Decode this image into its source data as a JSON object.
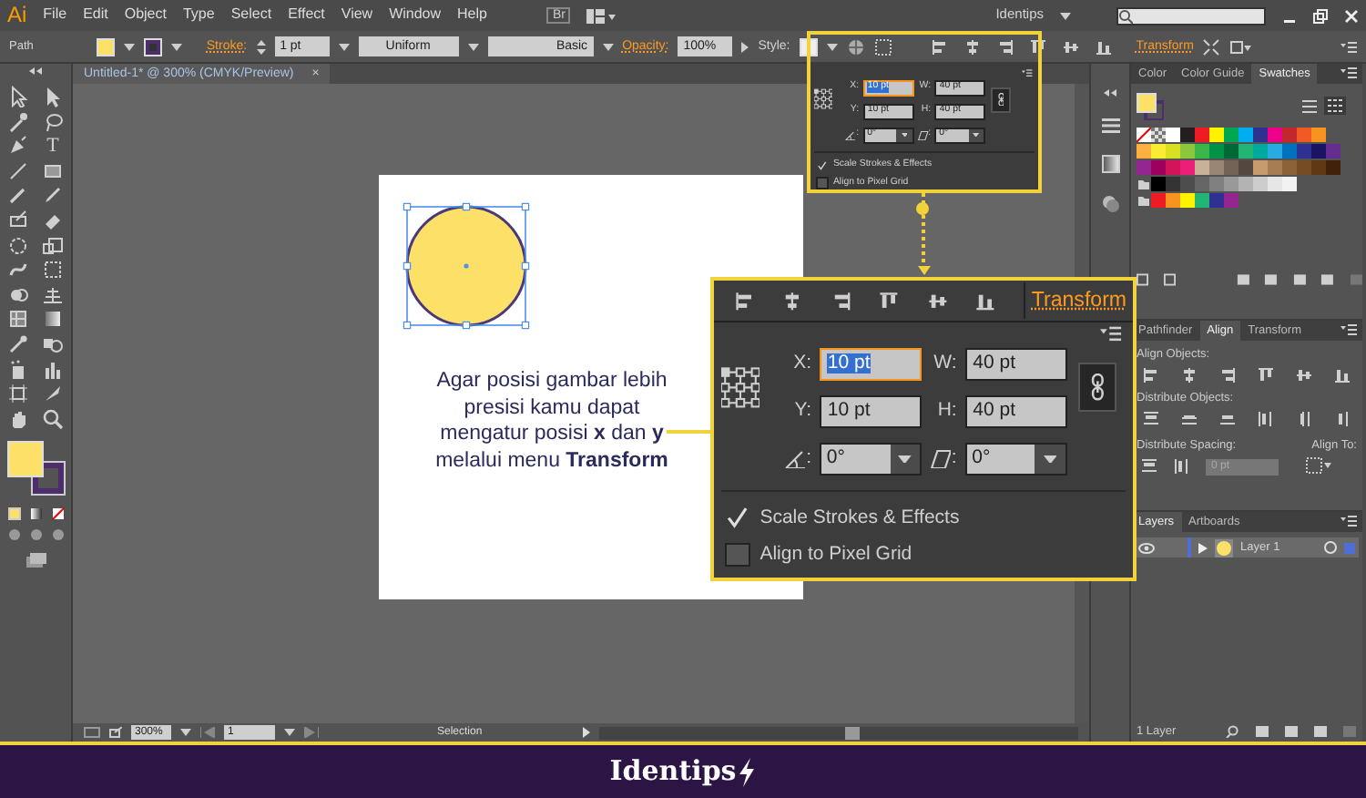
{
  "app": {
    "logo": "Ai",
    "bridge": "Br",
    "workspace": "Identips"
  },
  "menu": [
    "File",
    "Edit",
    "Object",
    "Type",
    "Select",
    "Effect",
    "View",
    "Window",
    "Help"
  ],
  "control_bar": {
    "object_type": "Path",
    "stroke_label": "Stroke:",
    "stroke_weight": "1 pt",
    "profile": "Uniform",
    "brush": "Basic",
    "opacity_label": "Opacity:",
    "opacity": "100%",
    "style_label": "Style:",
    "transform_link": "Transform"
  },
  "toolbar": {
    "type_tool": "T"
  },
  "document_tab": {
    "title": "Untitled-1* @ 300% (CMYK/Preview)",
    "close": "×"
  },
  "artboard": {
    "shape_selected": true,
    "note": "Agar posisi gambar lebih presisi kamu dapat mengatur posisi **x** dan **y** melalui menu **Transform**"
  },
  "transform_popup": {
    "fields": [
      {
        "label": "X:",
        "value": "10 pt",
        "focused": true
      },
      {
        "label": "W:",
        "value": "40 pt",
        "focused": false
      },
      {
        "label": "Y:",
        "value": "10 pt",
        "focused": false
      },
      {
        "label": "H:",
        "value": "40 pt",
        "focused": false
      }
    ],
    "angles": [
      {
        "kind": "rotate",
        "label": ":",
        "value": "0°"
      },
      {
        "kind": "shear",
        "label": ":",
        "value": "0°"
      }
    ],
    "options": [
      {
        "label": "Scale Strokes & Effects",
        "checked": true
      },
      {
        "label": "Align to Pixel Grid",
        "checked": false
      }
    ]
  },
  "transform_panel": {
    "tab": "Transform",
    "fields": [
      {
        "label": "X:",
        "value": "10 pt",
        "focused": true
      },
      {
        "label": "W:",
        "value": "40 pt",
        "focused": false
      },
      {
        "label": "Y:",
        "value": "10 pt",
        "focused": false
      },
      {
        "label": "H:",
        "value": "40 pt",
        "focused": false
      }
    ],
    "angles": [
      {
        "kind": "rotate",
        "label": ":",
        "value": "0°"
      },
      {
        "kind": "shear",
        "label": ":",
        "value": "0°"
      }
    ],
    "options": [
      {
        "label": "Scale Strokes & Effects",
        "checked": true
      },
      {
        "label": "Align to Pixel Grid",
        "checked": false
      }
    ]
  },
  "color_panel": {
    "tabs": [
      {
        "label": "Color",
        "selected": false
      },
      {
        "label": "Color Guide",
        "selected": false
      },
      {
        "label": "Swatches",
        "selected": true
      }
    ],
    "swatch_rows": [
      {
        "group": false,
        "swatches": [
          {
            "kind": "none"
          },
          {
            "kind": "registration"
          },
          {
            "kind": "color",
            "color": "#ffffff"
          },
          {
            "kind": "color",
            "color": "#231f20"
          },
          {
            "kind": "color",
            "color": "#ed1c24"
          },
          {
            "kind": "color",
            "color": "#fff200"
          },
          {
            "kind": "color",
            "color": "#00a651"
          },
          {
            "kind": "color",
            "color": "#00aeef"
          },
          {
            "kind": "color",
            "color": "#2e3192"
          },
          {
            "kind": "color",
            "color": "#ec008c"
          },
          {
            "kind": "color",
            "color": "#c1272d"
          },
          {
            "kind": "color",
            "color": "#f15a24"
          },
          {
            "kind": "color",
            "color": "#f7931e"
          }
        ]
      },
      {
        "group": false,
        "swatches": [
          {
            "kind": "color",
            "color": "#fbb040"
          },
          {
            "kind": "color",
            "color": "#f9ed32"
          },
          {
            "kind": "color",
            "color": "#d9e021"
          },
          {
            "kind": "color",
            "color": "#8cc63f"
          },
          {
            "kind": "color",
            "color": "#39b54a"
          },
          {
            "kind": "color",
            "color": "#009245"
          },
          {
            "kind": "color",
            "color": "#006837"
          },
          {
            "kind": "color",
            "color": "#22b573"
          },
          {
            "kind": "color",
            "color": "#00a99d"
          },
          {
            "kind": "color",
            "color": "#29abe2"
          },
          {
            "kind": "color",
            "color": "#0071bc"
          },
          {
            "kind": "color",
            "color": "#2e3192"
          },
          {
            "kind": "color",
            "color": "#1b1464"
          },
          {
            "kind": "color",
            "color": "#662d91"
          }
        ]
      },
      {
        "group": false,
        "swatches": [
          {
            "kind": "color",
            "color": "#93278f"
          },
          {
            "kind": "color",
            "color": "#9e005d"
          },
          {
            "kind": "color",
            "color": "#d4145a"
          },
          {
            "kind": "color",
            "color": "#ed1e79"
          },
          {
            "kind": "color",
            "color": "#c7b299"
          },
          {
            "kind": "color",
            "color": "#998675"
          },
          {
            "kind": "color",
            "color": "#736357"
          },
          {
            "kind": "color",
            "color": "#534741"
          },
          {
            "kind": "color",
            "color": "#c69c6d"
          },
          {
            "kind": "color",
            "color": "#a67c52"
          },
          {
            "kind": "color",
            "color": "#8c6239"
          },
          {
            "kind": "color",
            "color": "#754c24"
          },
          {
            "kind": "color",
            "color": "#603813"
          },
          {
            "kind": "color",
            "color": "#42210b"
          }
        ]
      },
      {
        "group": true,
        "swatches": [
          {
            "kind": "color",
            "color": "#000000"
          },
          {
            "kind": "color",
            "color": "#333333"
          },
          {
            "kind": "color",
            "color": "#4d4d4d"
          },
          {
            "kind": "color",
            "color": "#666666"
          },
          {
            "kind": "color",
            "color": "#808080"
          },
          {
            "kind": "color",
            "color": "#999999"
          },
          {
            "kind": "color",
            "color": "#b3b3b3"
          },
          {
            "kind": "color",
            "color": "#cccccc"
          },
          {
            "kind": "color",
            "color": "#e6e6e6"
          },
          {
            "kind": "color",
            "color": "#f2f2f2"
          }
        ]
      },
      {
        "group": true,
        "swatches": [
          {
            "kind": "color",
            "color": "#ed1c24"
          },
          {
            "kind": "color",
            "color": "#f7931e"
          },
          {
            "kind": "color",
            "color": "#fff200"
          },
          {
            "kind": "color",
            "color": "#22b573"
          },
          {
            "kind": "color",
            "color": "#2e3192"
          },
          {
            "kind": "color",
            "color": "#93278f"
          }
        ]
      }
    ]
  },
  "align_panel": {
    "tabs": [
      {
        "label": "Pathfinder",
        "selected": false
      },
      {
        "label": "Align",
        "selected": true
      },
      {
        "label": "Transform",
        "selected": false
      }
    ],
    "align_objects": "Align Objects:",
    "distribute_objects": "Distribute Objects:",
    "distribute_spacing": "Distribute Spacing:",
    "align_to": "Align To:",
    "spacing": "0 pt"
  },
  "layers_panel": {
    "tabs": [
      {
        "label": "Layers",
        "selected": true
      },
      {
        "label": "Artboards",
        "selected": false
      }
    ],
    "layers": [
      {
        "name": "Layer 1",
        "visible": true,
        "color": "#4f6fd6"
      }
    ],
    "count": "1 Layer"
  },
  "status_bar": {
    "zoom": "300%",
    "artboard": "1",
    "tool": "Selection"
  },
  "footer": {
    "brand": "Identips"
  }
}
